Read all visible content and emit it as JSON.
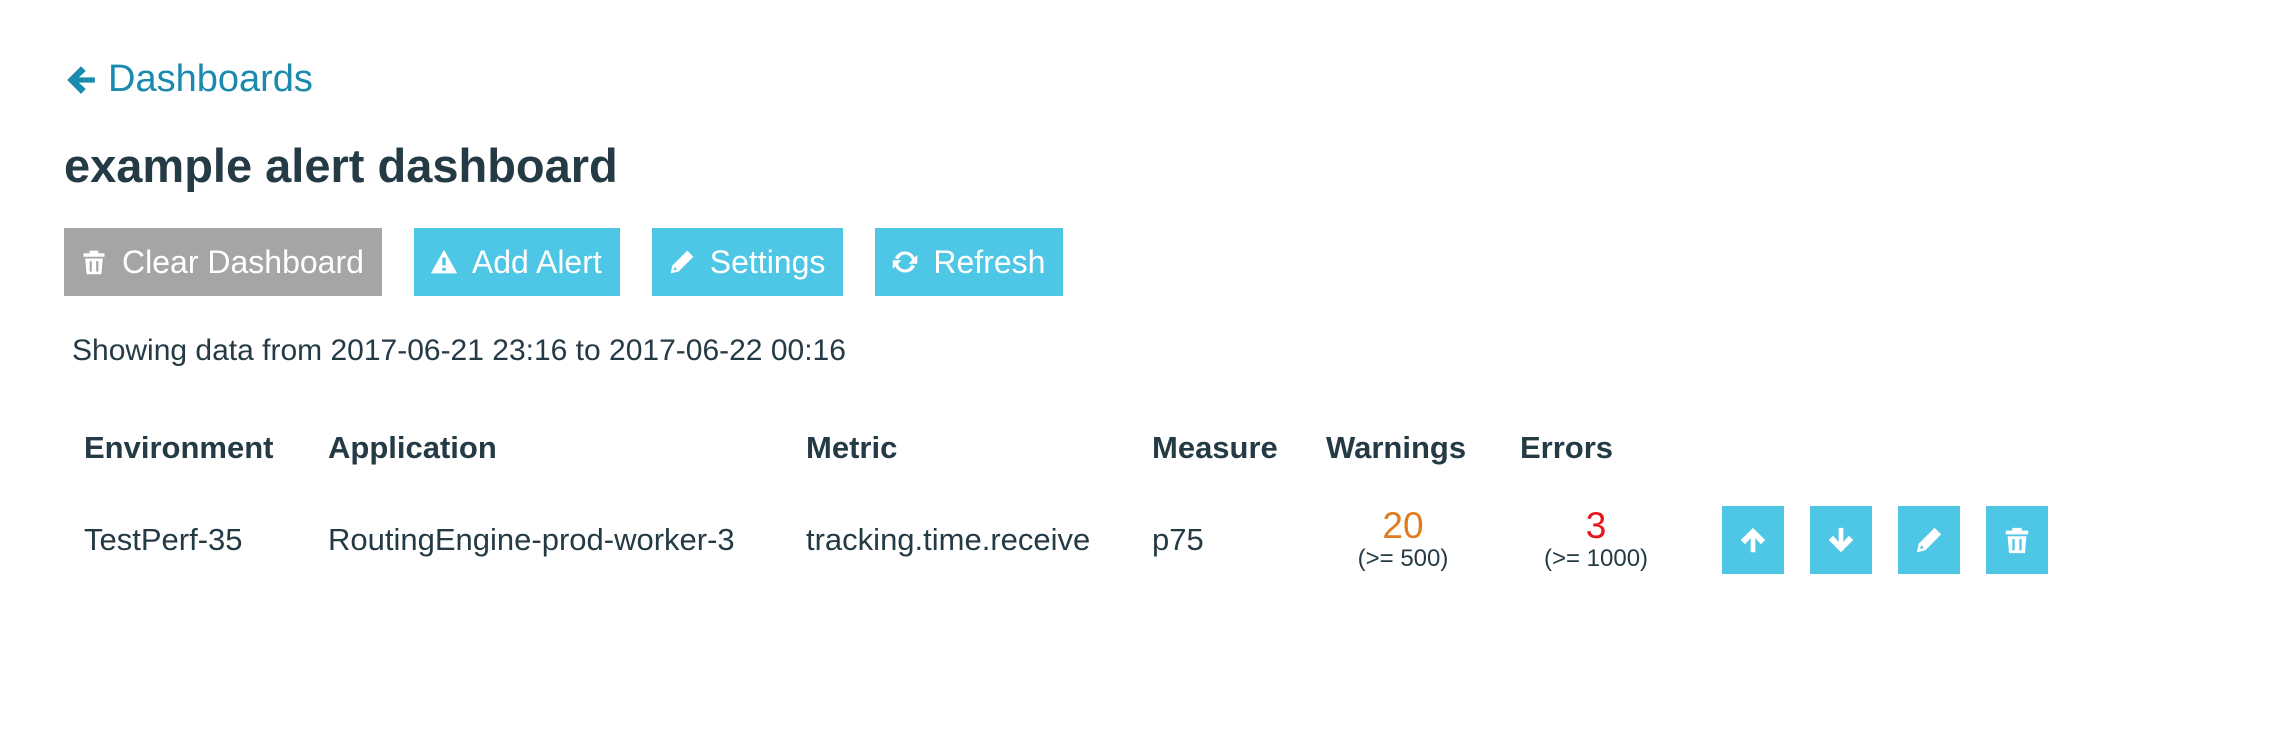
{
  "nav": {
    "back_label": "Dashboards"
  },
  "dashboard": {
    "title": "example alert dashboard",
    "date_range": "Showing data from 2017-06-21 23:16 to 2017-06-22 00:16"
  },
  "toolbar": {
    "clear_label": "Clear Dashboard",
    "add_alert_label": "Add Alert",
    "settings_label": "Settings",
    "refresh_label": "Refresh"
  },
  "table": {
    "headers": {
      "environment": "Environment",
      "application": "Application",
      "metric": "Metric",
      "measure": "Measure",
      "warnings": "Warnings",
      "errors": "Errors"
    },
    "rows": [
      {
        "environment": "TestPerf-35",
        "application": "RoutingEngine-prod-worker-3",
        "metric": "tracking.time.receive",
        "measure": "p75",
        "warnings": "20",
        "warnings_threshold": "(>= 500)",
        "errors": "3",
        "errors_threshold": "(>= 1000)"
      }
    ]
  },
  "icons": {
    "back": "arrow-left-icon",
    "clear": "trash-icon",
    "add_alert": "warning-triangle-icon",
    "settings": "pencil-icon",
    "refresh": "refresh-icon",
    "row_actions": [
      "arrow-up-icon",
      "arrow-down-icon",
      "pencil-icon",
      "trash-icon"
    ]
  },
  "colors": {
    "link": "#1a8aaf",
    "primary_button": "#4ec6e6",
    "clear_button": "#a5a5a5",
    "warning": "#e07b1f",
    "error": "#e8151c",
    "text": "#243a45"
  }
}
